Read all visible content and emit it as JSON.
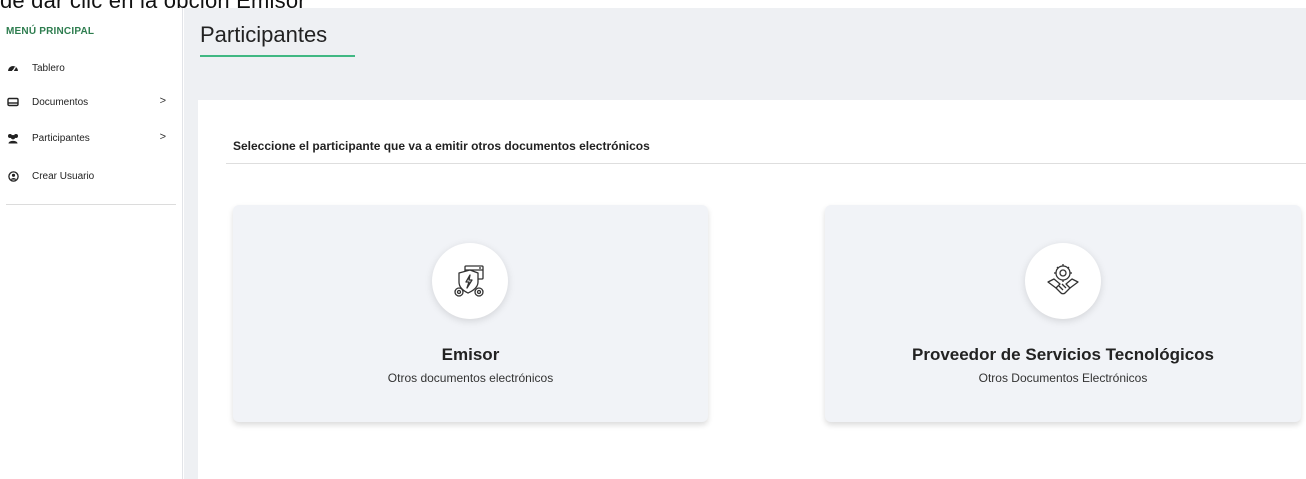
{
  "top_fragment": "de dar clic en la opción Emisor",
  "sidebar": {
    "title": "MENÚ PRINCIPAL",
    "items": [
      {
        "label": "Tablero",
        "icon": "dashboard-icon",
        "has_chevron": false
      },
      {
        "label": "Documentos",
        "icon": "inbox-icon",
        "has_chevron": true,
        "chevron": ">"
      },
      {
        "label": "Participantes",
        "icon": "users-icon",
        "has_chevron": true,
        "chevron": ">"
      },
      {
        "label": "Crear Usuario",
        "icon": "user-circle-icon",
        "has_chevron": false
      }
    ]
  },
  "page": {
    "title": "Participantes",
    "instruction": "Seleccione el participante que va a emitir otros documentos electrónicos"
  },
  "cards": [
    {
      "title": "Emisor",
      "subtitle": "Otros documentos electrónicos",
      "icon": "shield-server-gears-icon"
    },
    {
      "title": "Proveedor de Servicios Tecnológicos",
      "subtitle": "Otros Documentos Electrónicos",
      "icon": "handshake-gear-icon"
    }
  ],
  "colors": {
    "accent": "#41b883",
    "menu_title": "#2e7d4f",
    "card_bg": "#f1f3f7",
    "header_bg": "#eef0f3"
  }
}
